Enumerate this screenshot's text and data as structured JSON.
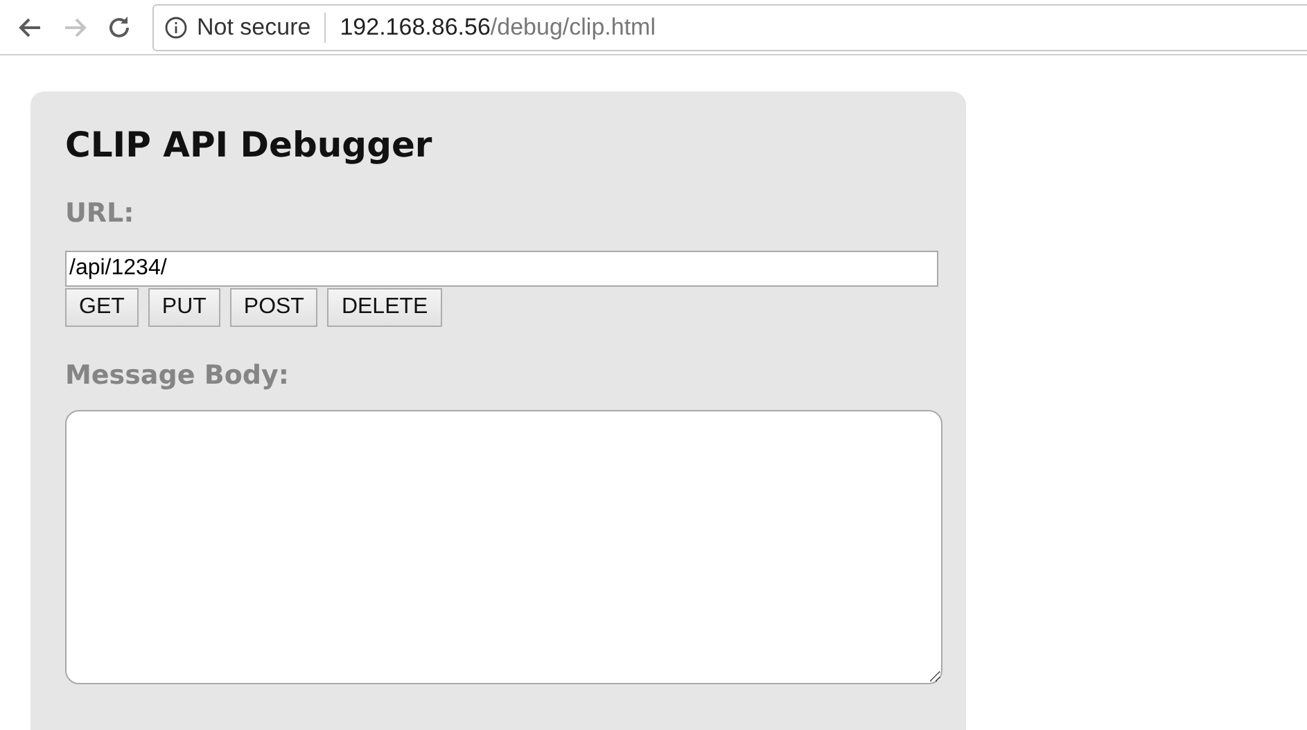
{
  "browser": {
    "back_disabled": false,
    "forward_disabled": true,
    "security": "Not secure",
    "url_host": "192.168.86.56",
    "url_path": "/debug/clip.html"
  },
  "page": {
    "title": "CLIP API Debugger",
    "url_label": "URL:",
    "url_value": "/api/1234/",
    "methods": [
      "GET",
      "PUT",
      "POST",
      "DELETE"
    ],
    "body_label": "Message Body:"
  }
}
